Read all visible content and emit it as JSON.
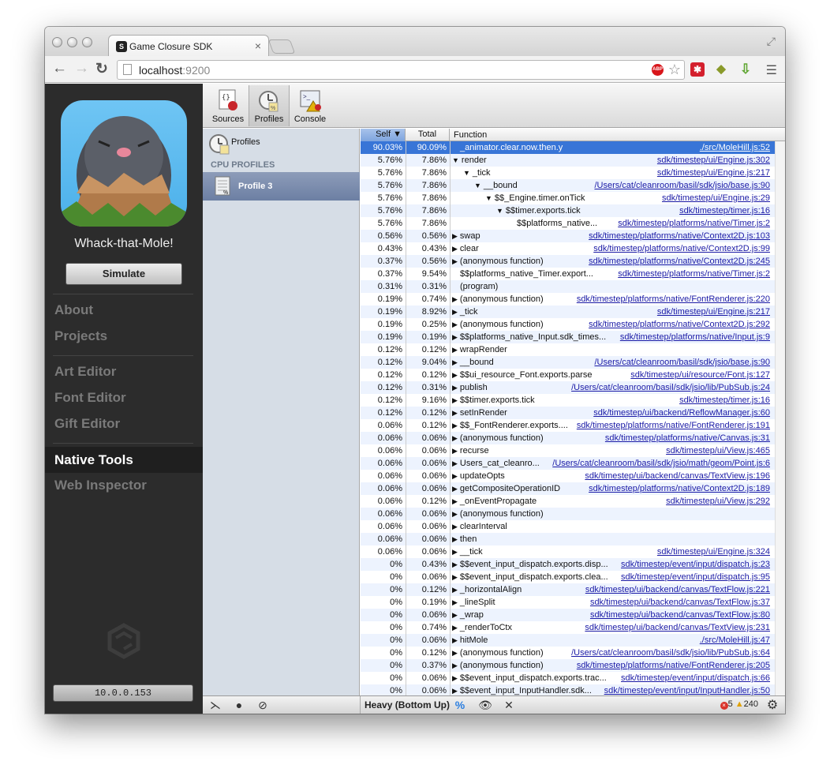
{
  "browser": {
    "tab_title": "Game Closure SDK",
    "tab_close": "×",
    "url_host": "localhost",
    "url_port": ":9200",
    "abp_label": "ABP"
  },
  "sidebar": {
    "app_name": "Whack-that-Mole!",
    "simulate_label": "Simulate",
    "nav_items": [
      {
        "label": "About"
      },
      {
        "label": "Projects"
      },
      {
        "label": "Art Editor"
      },
      {
        "label": "Font Editor"
      },
      {
        "label": "Gift Editor"
      },
      {
        "label": "Native Tools",
        "active": true
      },
      {
        "label": "Web Inspector"
      }
    ],
    "ip_address": "10.0.0.153"
  },
  "devtools": {
    "toolbar": [
      {
        "label": "Sources",
        "icon": "sources-icon"
      },
      {
        "label": "Profiles",
        "icon": "profiles-icon",
        "selected": true
      },
      {
        "label": "Console",
        "icon": "console-icon"
      }
    ],
    "profiles_panel": {
      "title": "Profiles",
      "section": "CPU PROFILES",
      "item": "Profile 3"
    },
    "grid": {
      "headers": {
        "self": "Self",
        "total": "Total",
        "function": "Function"
      },
      "rows": [
        {
          "self": "90.03%",
          "total": "90.09%",
          "fn": "_animator.clear.now.then.y",
          "indent": 0,
          "arrow": "",
          "link": "./src/MoleHill.js:52",
          "selected": true
        },
        {
          "self": "5.76%",
          "total": "7.86%",
          "fn": "render",
          "indent": 0,
          "arrow": "▼",
          "link": "sdk/timestep/ui/Engine.js:302"
        },
        {
          "self": "5.76%",
          "total": "7.86%",
          "fn": "_tick",
          "indent": 1,
          "arrow": "▼",
          "link": "sdk/timestep/ui/Engine.js:217"
        },
        {
          "self": "5.76%",
          "total": "7.86%",
          "fn": "__bound",
          "indent": 2,
          "arrow": "▼",
          "link": "/Users/cat/cleanroom/basil/sdk/jsio/base.js:90"
        },
        {
          "self": "5.76%",
          "total": "7.86%",
          "fn": "$$_Engine.timer.onTick",
          "indent": 3,
          "arrow": "▼",
          "link": "sdk/timestep/ui/Engine.js:29"
        },
        {
          "self": "5.76%",
          "total": "7.86%",
          "fn": "$$timer.exports.tick",
          "indent": 4,
          "arrow": "▼",
          "link": "sdk/timestep/timer.js:16"
        },
        {
          "self": "5.76%",
          "total": "7.86%",
          "fn": "$$platforms_native...",
          "indent": 5,
          "arrow": "",
          "link": "sdk/timestep/platforms/native/Timer.js:2"
        },
        {
          "self": "0.56%",
          "total": "0.56%",
          "fn": "swap",
          "indent": 0,
          "arrow": "▶",
          "link": "sdk/timestep/platforms/native/Context2D.js:103"
        },
        {
          "self": "0.43%",
          "total": "0.43%",
          "fn": "clear",
          "indent": 0,
          "arrow": "▶",
          "link": "sdk/timestep/platforms/native/Context2D.js:99"
        },
        {
          "self": "0.37%",
          "total": "0.56%",
          "fn": "(anonymous function)",
          "indent": 0,
          "arrow": "▶",
          "link": "sdk/timestep/platforms/native/Context2D.js:245"
        },
        {
          "self": "0.37%",
          "total": "9.54%",
          "fn": "$$platforms_native_Timer.export...",
          "indent": 0,
          "arrow": "",
          "link": "sdk/timestep/platforms/native/Timer.js:2"
        },
        {
          "self": "0.31%",
          "total": "0.31%",
          "fn": "(program)",
          "indent": 0,
          "arrow": "",
          "link": ""
        },
        {
          "self": "0.19%",
          "total": "0.74%",
          "fn": "(anonymous function)",
          "indent": 0,
          "arrow": "▶",
          "link": "sdk/timestep/platforms/native/FontRenderer.js:220"
        },
        {
          "self": "0.19%",
          "total": "8.92%",
          "fn": "_tick",
          "indent": 0,
          "arrow": "▶",
          "link": "sdk/timestep/ui/Engine.js:217"
        },
        {
          "self": "0.19%",
          "total": "0.25%",
          "fn": "(anonymous function)",
          "indent": 0,
          "arrow": "▶",
          "link": "sdk/timestep/platforms/native/Context2D.js:292"
        },
        {
          "self": "0.19%",
          "total": "0.19%",
          "fn": "$$platforms_native_Input.sdk_times...",
          "indent": 0,
          "arrow": "▶",
          "link": "sdk/timestep/platforms/native/Input.js:9"
        },
        {
          "self": "0.12%",
          "total": "0.12%",
          "fn": "wrapRender",
          "indent": 0,
          "arrow": "▶",
          "link": ""
        },
        {
          "self": "0.12%",
          "total": "9.04%",
          "fn": "__bound",
          "indent": 0,
          "arrow": "▶",
          "link": "/Users/cat/cleanroom/basil/sdk/jsio/base.js:90"
        },
        {
          "self": "0.12%",
          "total": "0.12%",
          "fn": "$$ui_resource_Font.exports.parse",
          "indent": 0,
          "arrow": "▶",
          "link": "sdk/timestep/ui/resource/Font.js:127"
        },
        {
          "self": "0.12%",
          "total": "0.31%",
          "fn": "publish",
          "indent": 0,
          "arrow": "▶",
          "link": "/Users/cat/cleanroom/basil/sdk/jsio/lib/PubSub.js:24"
        },
        {
          "self": "0.12%",
          "total": "9.16%",
          "fn": "$$timer.exports.tick",
          "indent": 0,
          "arrow": "▶",
          "link": "sdk/timestep/timer.js:16"
        },
        {
          "self": "0.12%",
          "total": "0.12%",
          "fn": "setInRender",
          "indent": 0,
          "arrow": "▶",
          "link": "sdk/timestep/ui/backend/ReflowManager.js:60"
        },
        {
          "self": "0.06%",
          "total": "0.12%",
          "fn": "$$_FontRenderer.exports....",
          "indent": 0,
          "arrow": "▶",
          "link": "sdk/timestep/platforms/native/FontRenderer.js:191"
        },
        {
          "self": "0.06%",
          "total": "0.06%",
          "fn": "(anonymous function)",
          "indent": 0,
          "arrow": "▶",
          "link": "sdk/timestep/platforms/native/Canvas.js:31"
        },
        {
          "self": "0.06%",
          "total": "0.06%",
          "fn": "recurse",
          "indent": 0,
          "arrow": "▶",
          "link": "sdk/timestep/ui/View.js:465"
        },
        {
          "self": "0.06%",
          "total": "0.06%",
          "fn": "Users_cat_cleanro...",
          "indent": 0,
          "arrow": "▶",
          "link": "/Users/cat/cleanroom/basil/sdk/jsio/math/geom/Point.js:6"
        },
        {
          "self": "0.06%",
          "total": "0.06%",
          "fn": "updateOpts",
          "indent": 0,
          "arrow": "▶",
          "link": "sdk/timestep/ui/backend/canvas/TextView.js:196"
        },
        {
          "self": "0.06%",
          "total": "0.06%",
          "fn": "getCompositeOperationID",
          "indent": 0,
          "arrow": "▶",
          "link": "sdk/timestep/platforms/native/Context2D.js:189"
        },
        {
          "self": "0.06%",
          "total": "0.12%",
          "fn": "_onEventPropagate",
          "indent": 0,
          "arrow": "▶",
          "link": "sdk/timestep/ui/View.js:292"
        },
        {
          "self": "0.06%",
          "total": "0.06%",
          "fn": "(anonymous function)",
          "indent": 0,
          "arrow": "▶",
          "link": ""
        },
        {
          "self": "0.06%",
          "total": "0.06%",
          "fn": "clearInterval",
          "indent": 0,
          "arrow": "▶",
          "link": ""
        },
        {
          "self": "0.06%",
          "total": "0.06%",
          "fn": "then",
          "indent": 0,
          "arrow": "▶",
          "link": ""
        },
        {
          "self": "0.06%",
          "total": "0.06%",
          "fn": "__tick",
          "indent": 0,
          "arrow": "▶",
          "link": "sdk/timestep/ui/Engine.js:324"
        },
        {
          "self": "0%",
          "total": "0.43%",
          "fn": "$$event_input_dispatch.exports.disp...",
          "indent": 0,
          "arrow": "▶",
          "link": "sdk/timestep/event/input/dispatch.js:23"
        },
        {
          "self": "0%",
          "total": "0.06%",
          "fn": "$$event_input_dispatch.exports.clea...",
          "indent": 0,
          "arrow": "▶",
          "link": "sdk/timestep/event/input/dispatch.js:95"
        },
        {
          "self": "0%",
          "total": "0.12%",
          "fn": "_horizontalAlign",
          "indent": 0,
          "arrow": "▶",
          "link": "sdk/timestep/ui/backend/canvas/TextFlow.js:221"
        },
        {
          "self": "0%",
          "total": "0.19%",
          "fn": "_lineSplit",
          "indent": 0,
          "arrow": "▶",
          "link": "sdk/timestep/ui/backend/canvas/TextFlow.js:37"
        },
        {
          "self": "0%",
          "total": "0.06%",
          "fn": "_wrap",
          "indent": 0,
          "arrow": "▶",
          "link": "sdk/timestep/ui/backend/canvas/TextFlow.js:80"
        },
        {
          "self": "0%",
          "total": "0.74%",
          "fn": "_renderToCtx",
          "indent": 0,
          "arrow": "▶",
          "link": "sdk/timestep/ui/backend/canvas/TextView.js:231"
        },
        {
          "self": "0%",
          "total": "0.06%",
          "fn": "hitMole",
          "indent": 0,
          "arrow": "▶",
          "link": "./src/MoleHill.js:47"
        },
        {
          "self": "0%",
          "total": "0.12%",
          "fn": "(anonymous function)",
          "indent": 0,
          "arrow": "▶",
          "link": "/Users/cat/cleanroom/basil/sdk/jsio/lib/PubSub.js:64"
        },
        {
          "self": "0%",
          "total": "0.37%",
          "fn": "(anonymous function)",
          "indent": 0,
          "arrow": "▶",
          "link": "sdk/timestep/platforms/native/FontRenderer.js:205"
        },
        {
          "self": "0%",
          "total": "0.06%",
          "fn": "$$event_input_dispatch.exports.trac...",
          "indent": 0,
          "arrow": "▶",
          "link": "sdk/timestep/event/input/dispatch.js:66"
        },
        {
          "self": "0%",
          "total": "0.06%",
          "fn": "$$event_input_InputHandler.sdk...",
          "indent": 0,
          "arrow": "▶",
          "link": "sdk/timestep/event/input/InputHandler.js:50"
        }
      ]
    },
    "statusbar": {
      "mode": "Heavy (Bottom Up)",
      "errors": "5",
      "warnings": "240"
    }
  },
  "colors": {
    "sidebar_bg": "#2c2c2c",
    "selection": "#3875d7",
    "link": "#1a1aa6"
  }
}
